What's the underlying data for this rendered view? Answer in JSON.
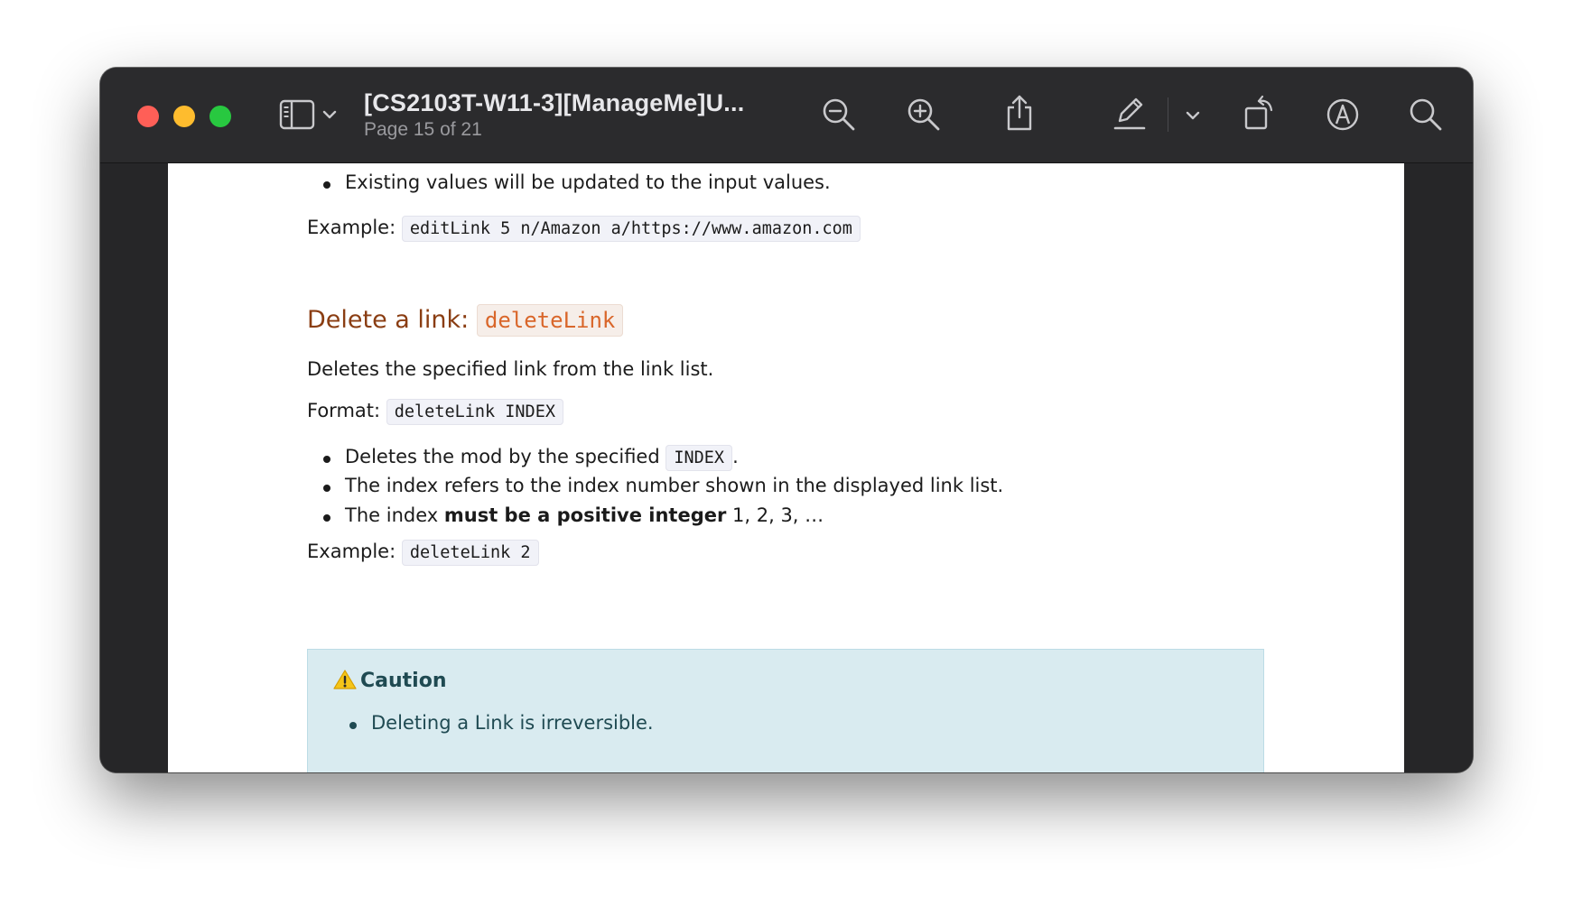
{
  "window": {
    "title": "[CS2103T-W11-3][ManageMe]U...",
    "subtitle": "Page 15 of 21"
  },
  "toolbar": {
    "icons": [
      "sidebar-icon",
      "chevron-down-icon",
      "zoom-out-icon",
      "zoom-in-icon",
      "share-icon",
      "markup-pen-icon",
      "chevron-down-icon",
      "rotate-icon",
      "annotate-icon",
      "search-icon"
    ]
  },
  "document": {
    "prev_bullet": "Existing values will be updated to the input values.",
    "prev_example": {
      "label": "Example:",
      "code": "editLink 5 n/Amazon a/https://www.amazon.com"
    },
    "section": {
      "heading_text": "Delete a link:",
      "heading_code": "deleteLink",
      "description": "Deletes the specified link from the link list.",
      "format_label": "Format:",
      "format_code": "deleteLink INDEX",
      "bullets": [
        {
          "before": "Deletes the mod by the specified",
          "code": "INDEX",
          "after": "."
        },
        {
          "text": "The index refers to the index number shown in the displayed link list."
        },
        {
          "before": "The index",
          "bold": "must be a positive integer",
          "after": "1, 2, 3, …"
        }
      ],
      "example_label": "Example:",
      "example_code": "deleteLink 2"
    },
    "caution": {
      "icon": "warning-icon",
      "title": "Caution",
      "items": [
        "Deleting a Link is irreversible."
      ]
    }
  }
}
